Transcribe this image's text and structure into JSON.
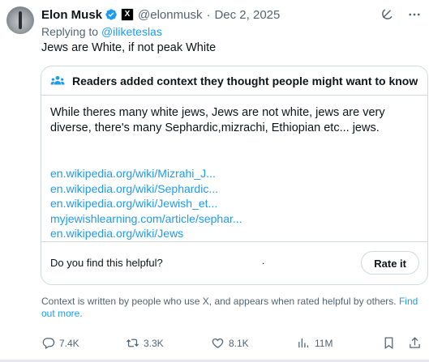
{
  "author": {
    "name": "Elon Musk",
    "handle": "@elonmusk",
    "date": "Dec 2, 2025"
  },
  "reply": {
    "prefix": "Replying to ",
    "user": "@iliketeslas"
  },
  "post_text": "Jews are White, if not peak White",
  "community_note": {
    "title": "Readers added context they thought people might want to know",
    "text": "While theres many white jews, Jews are not white, jews are very diverse, there's many Sephardic,mizrachi, Ethiopian etc... jews.",
    "links": [
      "en.wikipedia.org/wiki/Mizrahi_J...",
      "en.wikipedia.org/wiki/Sephardic...",
      "en.wikipedia.org/wiki/Jewish_et...",
      "myjewishlearning.com/article/sephar...",
      "en.wikipedia.org/wiki/Jews"
    ],
    "helpful_question": "Do you find this helpful?",
    "dot": ".",
    "rate_label": "Rate it"
  },
  "context_footer": {
    "text": "Context is written by people who use X, and appears when rated helpful by others.",
    "link": "Find out more."
  },
  "actions": {
    "replies": "7.4K",
    "reposts": "3.3K",
    "likes": "8.1K",
    "views": "11M"
  },
  "colors": {
    "accent": "#1d9bf0",
    "muted": "#536471",
    "border": "#cfd9de",
    "text": "#0f1419"
  },
  "icons": [
    "verified-badge-icon",
    "x-affiliate-icon",
    "grok-icon",
    "more-icon",
    "community-note-icon",
    "reply-icon",
    "repost-icon",
    "like-icon",
    "views-icon",
    "bookmark-icon",
    "share-icon"
  ]
}
